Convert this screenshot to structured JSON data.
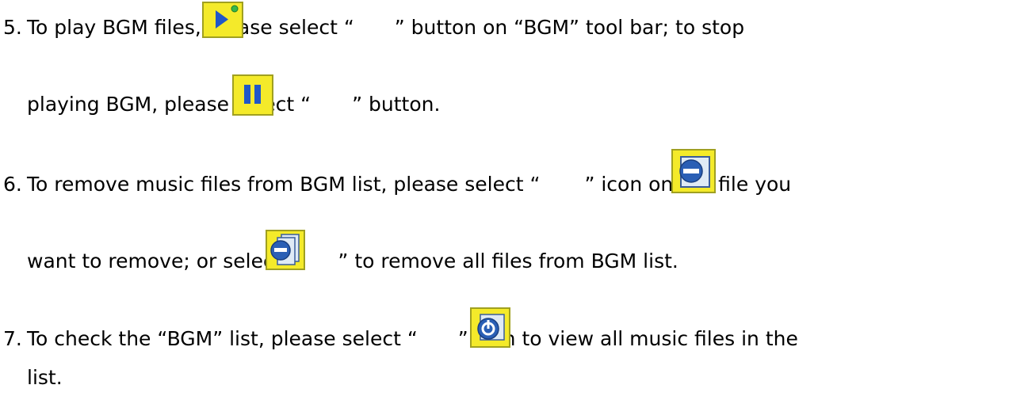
{
  "step5": {
    "number": "5.",
    "text_a": "To play BGM files, please select “",
    "text_b": "” button on “BGM” tool bar; to stop",
    "text_c": "playing BGM, please select “",
    "text_d": "” button.",
    "play_icon": "play-button-icon",
    "pause_icon": "pause-button-icon"
  },
  "step6": {
    "number": "6.",
    "text_a": "To remove music files from BGM list, please select “",
    "text_b": "” icon on the file you",
    "text_c": "want to remove; or select “",
    "text_d": "” to remove all files from BGM list.",
    "remove_icon": "remove-file-icon",
    "remove_all_icon": "remove-all-files-icon"
  },
  "step7": {
    "number": "7.",
    "text_a": "To check the “BGM” list, please select “",
    "text_b": "” icon to view all music files in the",
    "text_c": "list.",
    "check_icon": "view-bgm-list-icon"
  },
  "colors": {
    "icon_yellow": "#f4ea2a",
    "icon_border": "#a0a020",
    "play_blue": "#1f57c8",
    "dot_green": "#35b84a",
    "minus_blue": "#2a5fb5",
    "page_bg": "#dfeaf5"
  }
}
